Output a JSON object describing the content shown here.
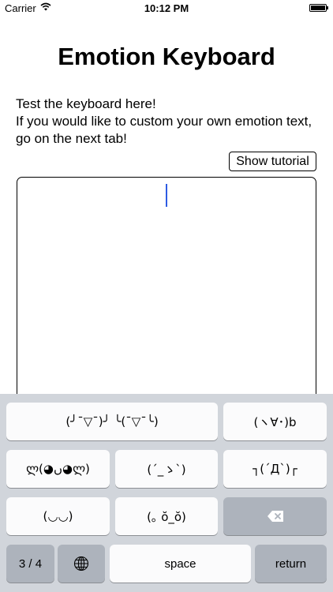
{
  "status_bar": {
    "carrier": "Carrier",
    "time": "10:12 PM",
    "wifi_icon": "wifi-icon",
    "battery_icon": "battery-icon"
  },
  "header": {
    "title": "Emotion Keyboard"
  },
  "intro": {
    "line1": "Test the keyboard here!",
    "line2": "If you would like to custom your own emotion text, go on the next tab!"
  },
  "tutorial_button": {
    "label": "Show tutorial"
  },
  "keyboard": {
    "row1": [
      "(╯¯▽¯)╯  ╰(¯▽¯╰)",
      "(ヽ∀･)b"
    ],
    "row2": [
      "ლ(◕ں◕ლ)",
      "(´_ゝ`)",
      "┐(´Д`)┌"
    ],
    "row3": [
      "(◡◡)",
      "(｡ ŏ_ŏ)"
    ],
    "backspace_icon": "backspace-icon",
    "page_indicator": "3 / 4",
    "globe_icon": "globe-icon",
    "space_label": "space",
    "return_label": "return"
  },
  "colors": {
    "keyboard_bg": "#d1d5db",
    "key_bg": "#fbfbfc",
    "dark_key_bg": "#adb3bc",
    "caret": "#2d5be3"
  }
}
